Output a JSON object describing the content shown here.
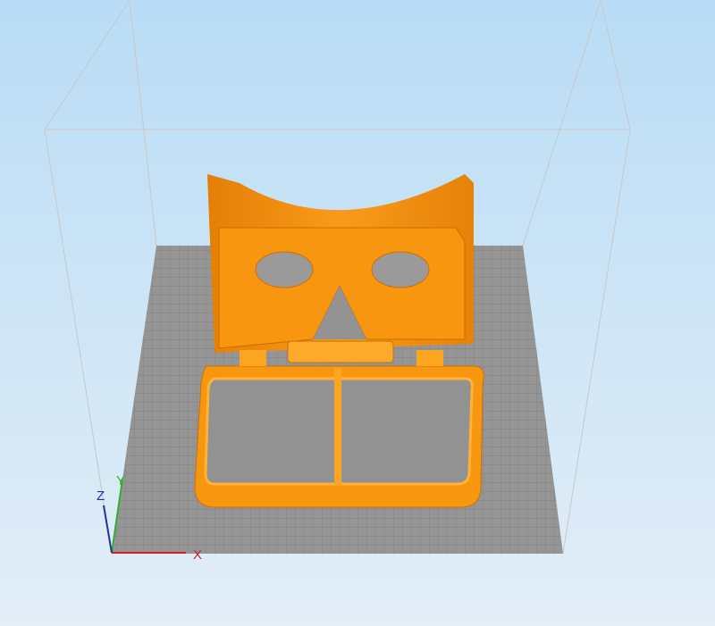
{
  "viewport": {
    "title": "3D preview"
  },
  "axes": {
    "x_label": "X",
    "y_label": "Y",
    "z_label": "Z"
  },
  "colors": {
    "object": "#f9920f",
    "object_dark": "#d97706",
    "bed": "#8f8f8f",
    "x_axis": "#d02020",
    "y_axis": "#30b030",
    "z_axis": "#2030a0"
  }
}
